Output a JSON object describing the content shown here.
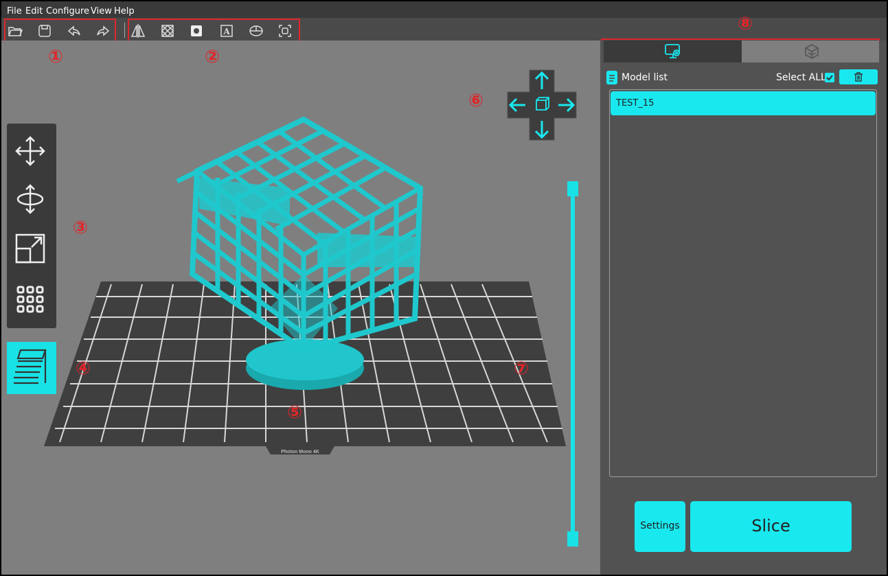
{
  "menu": {
    "items": [
      "File",
      "Edit",
      "Configure",
      "View",
      "Help"
    ]
  },
  "toolbar": {
    "file_group": [
      "open-folder-icon",
      "save-icon",
      "undo-icon",
      "redo-icon"
    ],
    "edit_group": [
      "mirror-icon",
      "support-icon",
      "hollow-icon",
      "text-icon",
      "slice-plane-icon",
      "auto-layout-icon"
    ]
  },
  "annotations": {
    "n1": "①",
    "n2": "②",
    "n3": "③",
    "n4": "④",
    "n5": "⑤",
    "n6": "⑥",
    "n7": "⑦",
    "n8": "⑧",
    "color": "#e0262a"
  },
  "left_tools": [
    "move-icon",
    "rotate-icon",
    "scale-icon",
    "arrange-icon"
  ],
  "viewport": {
    "build_plate_label": "Photon Mono 4K",
    "accent": "#19e2e6"
  },
  "right_panel": {
    "tabs": [
      "model-settings-tab-icon",
      "print-settings-tab-icon"
    ],
    "model_list": {
      "title": "Model list",
      "select_all_label": "Select ALL",
      "select_all_checked": true,
      "items": [
        "TEST_15"
      ]
    },
    "buttons": {
      "settings": "Settings",
      "slice": "Slice"
    }
  },
  "colors": {
    "background": "#7f7f7f",
    "panel": "#525252",
    "toolbar": "#4a4a4a",
    "accent": "#19e8ef"
  }
}
